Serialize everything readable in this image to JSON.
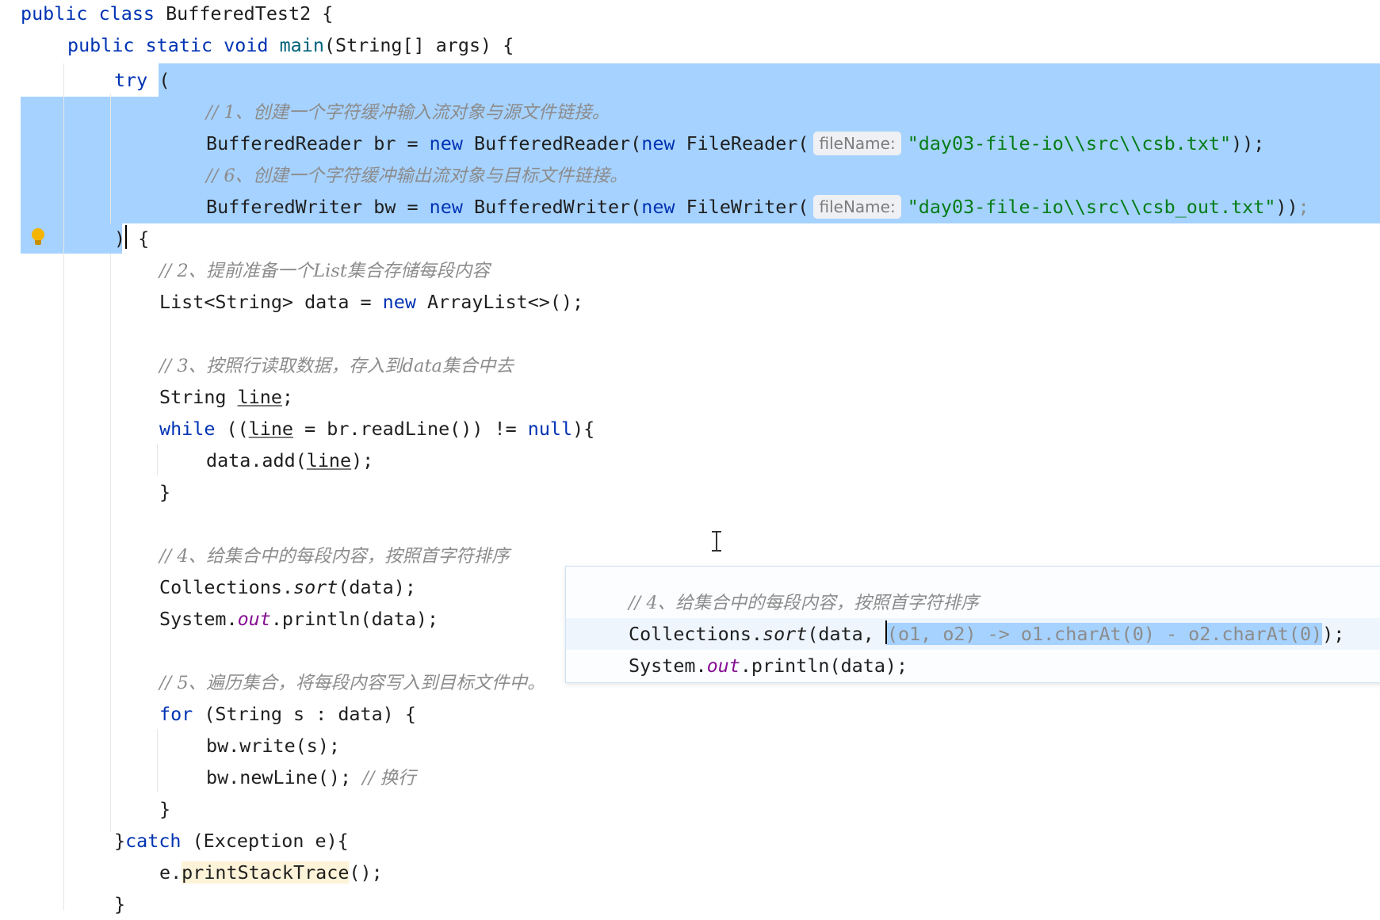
{
  "code": {
    "class_kw": "public class",
    "class_name": " BufferedTest2 {",
    "main_kw1": "public static void",
    "main_name": " main",
    "main_rest": "(String[] args) {",
    "try_kw": "try",
    "try_open": " (",
    "c1": "// 1、创建一个字符缓冲输入流对象与源文件链接。",
    "br_a": "BufferedReader br = ",
    "new": "new",
    "br_b": " BufferedReader(",
    "fr": " FileReader(",
    "hint": "fileName:",
    "br_path": "\"day03-file-io\\\\src\\\\csb.txt\"",
    "br_end": "));",
    "c6": "// 6、创建一个字符缓冲输出流对象与目标文件链接。",
    "bw_a": "BufferedWriter bw = ",
    "bw_b": " BufferedWriter(",
    "fw": " FileWriter(",
    "bw_path": "\"day03-file-io\\\\src\\\\csb_out.txt\"",
    "bw_end": "))",
    "semi": ";",
    "close_paren": ")",
    "open_brace": " {",
    "c2": "// 2、提前准备一个List集合存储每段内容",
    "list_a": "List<String> data = ",
    "list_b": " ArrayList<>();",
    "c3": "// 3、按照行读取数据，存入到data集合中去",
    "str_decl_a": "String ",
    "line_var": "line",
    "while_kw": "while",
    "while_a": " ((",
    "while_b": " = br.readLine()) != ",
    "null_kw": "null",
    "while_c": "){",
    "add_a": "data.add(",
    "add_b": ");",
    "brace": "}",
    "c4": "// 4、给集合中的每段内容，按照首字符排序",
    "coll_a": "Collections.",
    "sort": "sort",
    "coll_b": "(data);",
    "sys_a": "System.",
    "out": "out",
    "sys_b": ".println(data);",
    "c5": "// 5、遍历集合，将每段内容写入到目标文件中。",
    "for_kw": "for",
    "for_rest": " (String s : data) {",
    "write": "bw.write(s);",
    "newline": "bw.newLine(); ",
    "c_nl": "// 换行",
    "catch_a": "}",
    "catch_kw": "catch",
    "catch_b": " (Exception e){",
    "pst_a": "e.",
    "pst_b": "printStackTrace",
    "pst_c": "();",
    "close_final": "}"
  },
  "popup": {
    "comment": "// 4、给集合中的每段内容，按照首字符排序",
    "coll_a": "Collections.",
    "sort": "sort",
    "coll_b": "(data, ",
    "lambda": "(o1, o2) -> o1.charAt(0) - o2.charAt(0)",
    "coll_end": ");",
    "sys_a": "System.",
    "out": "out",
    "sys_b": ".println(data);"
  }
}
